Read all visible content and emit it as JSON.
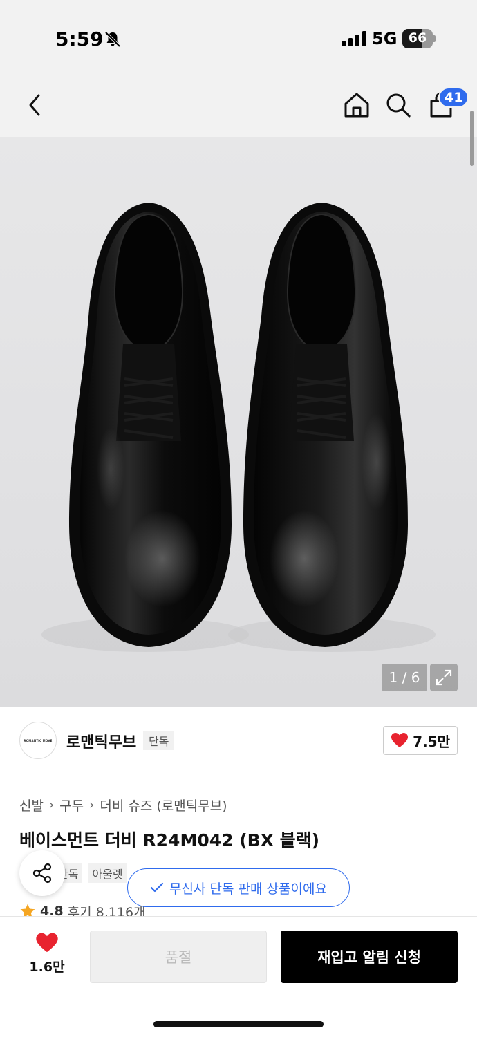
{
  "status_bar": {
    "time": "5:59",
    "network": "5G",
    "battery_percent": 66,
    "battery_text": "66",
    "icons": [
      "bell-off-icon",
      "signal-icon",
      "battery-icon"
    ]
  },
  "header": {
    "icons": [
      "chevron-left-icon",
      "home-icon",
      "search-icon",
      "shopping-bag-icon"
    ],
    "cart_badge": "41"
  },
  "gallery": {
    "counter": "1 / 6",
    "current": 1,
    "total": 6,
    "icons": [
      "expand-icon"
    ]
  },
  "brand": {
    "logo_text": "ROMANTIC MOVE",
    "name": "로맨틱무브",
    "tag": "단독",
    "like_count": "7.5만",
    "accent_color": "#e8232f"
  },
  "breadcrumb": [
    "신발",
    "구두",
    "더비 슈즈 (로맨틱무브)"
  ],
  "product": {
    "title": "베이스먼트 더비 R24M042 (BX 블랙)",
    "tags": [
      "단독",
      "아울렛"
    ],
    "rating": "4.8",
    "reviews": "후기 8,116개"
  },
  "exclusive_notice": "무신사 단독 판매 상품이에요",
  "bottom_bar": {
    "wish_count": "1.6만",
    "soldout_label": "품절",
    "restock_label": "재입고 알림 신청"
  },
  "colors": {
    "accent_blue": "#2f6bed",
    "heart_red": "#e8232f",
    "star_orange": "#f5a623",
    "primary_black": "#000000"
  }
}
